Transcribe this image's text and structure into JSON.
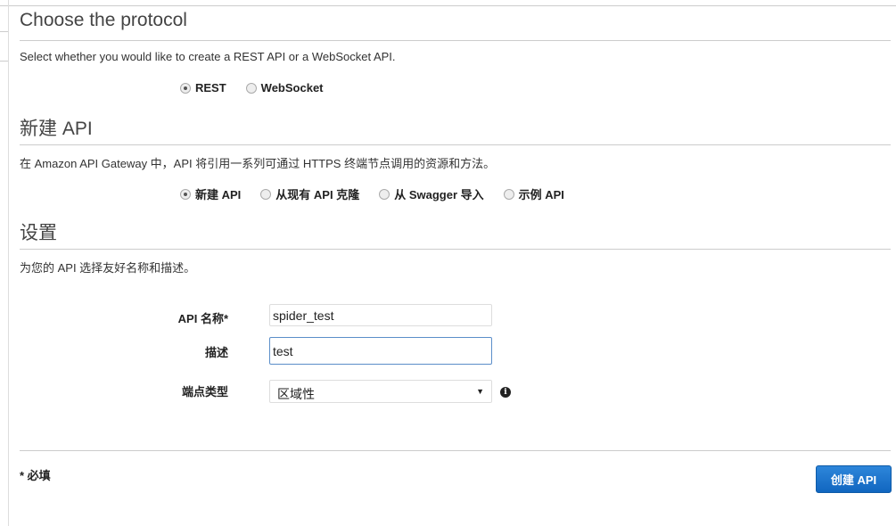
{
  "protocol": {
    "title": "Choose the protocol",
    "description": "Select whether you would like to create a REST API or a WebSocket API.",
    "options": [
      {
        "label": "REST",
        "selected": true
      },
      {
        "label": "WebSocket",
        "selected": false
      }
    ]
  },
  "new_api": {
    "title": "新建 API",
    "description": "在 Amazon API Gateway 中，API 将引用一系列可通过 HTTPS 终端节点调用的资源和方法。",
    "options": [
      {
        "label": "新建 API",
        "selected": true
      },
      {
        "label": "从现有 API 克隆",
        "selected": false
      },
      {
        "label": "从 Swagger 导入",
        "selected": false
      },
      {
        "label": "示例 API",
        "selected": false
      }
    ]
  },
  "settings": {
    "title": "设置",
    "description": "为您的 API 选择友好名称和描述。",
    "name_label": "API 名称*",
    "name_value": "spider_test",
    "desc_label": "描述",
    "desc_value": "test",
    "endpoint_label": "端点类型",
    "endpoint_value": "区域性",
    "info_icon": "info-icon"
  },
  "footer": {
    "required": "* 必填",
    "create_button": "创建 API",
    "button_color": "#1a73cc"
  }
}
